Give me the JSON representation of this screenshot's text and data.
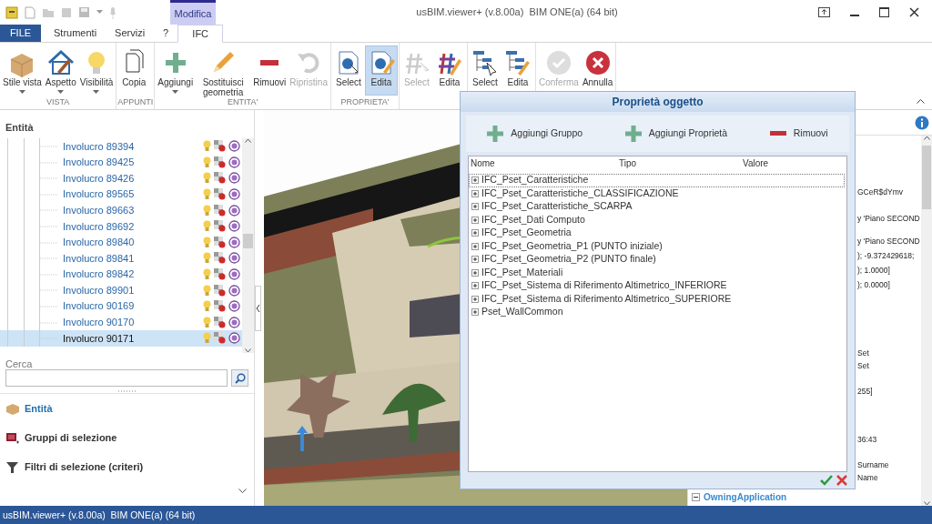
{
  "window": {
    "title": "usBIM.viewer+ (v.8.00a)  BIM ONE(a) (64 bit)"
  },
  "context_tab": {
    "label": "Modifica"
  },
  "tabs": [
    {
      "label": "FILE",
      "kind": "file",
      "selected": false
    },
    {
      "label": "Strumenti",
      "kind": "tab",
      "selected": false
    },
    {
      "label": "Servizi",
      "kind": "tab",
      "selected": false
    },
    {
      "label": "?",
      "kind": "tab",
      "selected": false
    },
    {
      "label": "IFC",
      "kind": "context",
      "selected": true
    }
  ],
  "ribbon": {
    "groups": [
      {
        "label": "VISTA",
        "buttons": [
          {
            "label": "Stile vista",
            "dropdown": true,
            "disabled": false,
            "selected": false
          },
          {
            "label": "Aspetto",
            "dropdown": true,
            "disabled": false,
            "selected": false
          },
          {
            "label": "Visibilità",
            "dropdown": true,
            "disabled": false,
            "selected": false
          }
        ]
      },
      {
        "label": "APPUNTI",
        "buttons": [
          {
            "label": "Copia",
            "dropdown": false,
            "disabled": false,
            "selected": false
          }
        ]
      },
      {
        "label": "ENTITA'",
        "buttons": [
          {
            "label": "Aggiungi",
            "dropdown": true,
            "disabled": false,
            "selected": false
          },
          {
            "label": "Sostituisci geometria",
            "dropdown": false,
            "disabled": false,
            "selected": false
          },
          {
            "label": "Rimuovi",
            "dropdown": false,
            "disabled": false,
            "selected": false
          },
          {
            "label": "Ripristina",
            "dropdown": false,
            "disabled": true,
            "selected": false
          }
        ]
      },
      {
        "label": "PROPRIETA'",
        "buttons": [
          {
            "label": "Select",
            "dropdown": false,
            "disabled": false,
            "selected": false
          },
          {
            "label": "Edita",
            "dropdown": false,
            "disabled": false,
            "selected": true
          }
        ]
      },
      {
        "buttons": [
          {
            "label": "Select",
            "dropdown": false,
            "disabled": true,
            "selected": false
          },
          {
            "label": "Edita",
            "dropdown": false,
            "disabled": false,
            "selected": false
          }
        ]
      },
      {
        "buttons": [
          {
            "label": "Select",
            "dropdown": false,
            "disabled": false,
            "selected": false
          },
          {
            "label": "Edita",
            "dropdown": false,
            "disabled": false,
            "selected": false
          }
        ]
      },
      {
        "buttons": [
          {
            "label": "Conferma",
            "dropdown": false,
            "disabled": true,
            "selected": false
          },
          {
            "label": "Annulla",
            "dropdown": false,
            "disabled": false,
            "selected": false
          }
        ]
      }
    ]
  },
  "entity_panel": {
    "title": "Entità",
    "tree": [
      {
        "label": "Involucro 89394",
        "selected": false
      },
      {
        "label": "Involucro 89425",
        "selected": false
      },
      {
        "label": "Involucro 89426",
        "selected": false
      },
      {
        "label": "Involucro 89565",
        "selected": false
      },
      {
        "label": "Involucro 89663",
        "selected": false
      },
      {
        "label": "Involucro 89692",
        "selected": false
      },
      {
        "label": "Involucro 89840",
        "selected": false
      },
      {
        "label": "Involucro 89841",
        "selected": false
      },
      {
        "label": "Involucro 89842",
        "selected": false
      },
      {
        "label": "Involucro 89901",
        "selected": false
      },
      {
        "label": "Involucro 90169",
        "selected": false
      },
      {
        "label": "Involucro 90170",
        "selected": false
      },
      {
        "label": "Involucro 90171",
        "selected": true
      }
    ],
    "search": {
      "label": "Cerca"
    },
    "nav": [
      {
        "label": "Entità",
        "selected": true
      },
      {
        "label": "Gruppi di selezione",
        "selected": false
      },
      {
        "label": "Filtri di selezione (criteri)",
        "selected": false
      }
    ]
  },
  "dialog": {
    "title": "Proprietà oggetto",
    "toolbar": [
      {
        "label": "Aggiungi Gruppo",
        "kind": "add"
      },
      {
        "label": "Aggiungi Proprietà",
        "kind": "add"
      },
      {
        "label": "Rimuovi",
        "kind": "remove"
      }
    ],
    "columns": [
      "Nome",
      "Tipo",
      "Valore"
    ],
    "rows": [
      {
        "label": "IFC_Pset_Caratteristiche",
        "focused": true
      },
      {
        "label": "IFC_Pset_Caratteristiche_CLASSIFICAZIONE",
        "focused": false
      },
      {
        "label": "IFC_Pset_Caratteristiche_SCARPA",
        "focused": false
      },
      {
        "label": "IFC_Pset_Dati Computo",
        "focused": false
      },
      {
        "label": "IFC_Pset_Geometria",
        "focused": false
      },
      {
        "label": "IFC_Pset_Geometria_P1 (PUNTO iniziale)",
        "focused": false
      },
      {
        "label": "IFC_Pset_Geometria_P2 (PUNTO finale)",
        "focused": false
      },
      {
        "label": "IFC_Pset_Materiali",
        "focused": false
      },
      {
        "label": "IFC_Pset_Sistema di Riferimento Altimetrico_INFERIORE",
        "focused": false
      },
      {
        "label": "IFC_Pset_Sistema di Riferimento Altimetrico_SUPERIORE",
        "focused": false
      },
      {
        "label": "Pset_WallCommon",
        "focused": false
      }
    ]
  },
  "properties_panel": {
    "fragments": [
      "GCeR$dYmv",
      "y 'Piano SECOND",
      "y 'Piano SECOND",
      "); -9.372429618;",
      "); 1.0000]",
      "); 0.0000]",
      "Set",
      "Set",
      "255]",
      "36:43",
      "Surname",
      "Name"
    ],
    "group": {
      "label": "OwningApplication",
      "expanded": true
    }
  },
  "status_bar": {
    "text": "usBIM.viewer+ (v.8.00a)  BIM ONE(a) (64 bit)"
  }
}
